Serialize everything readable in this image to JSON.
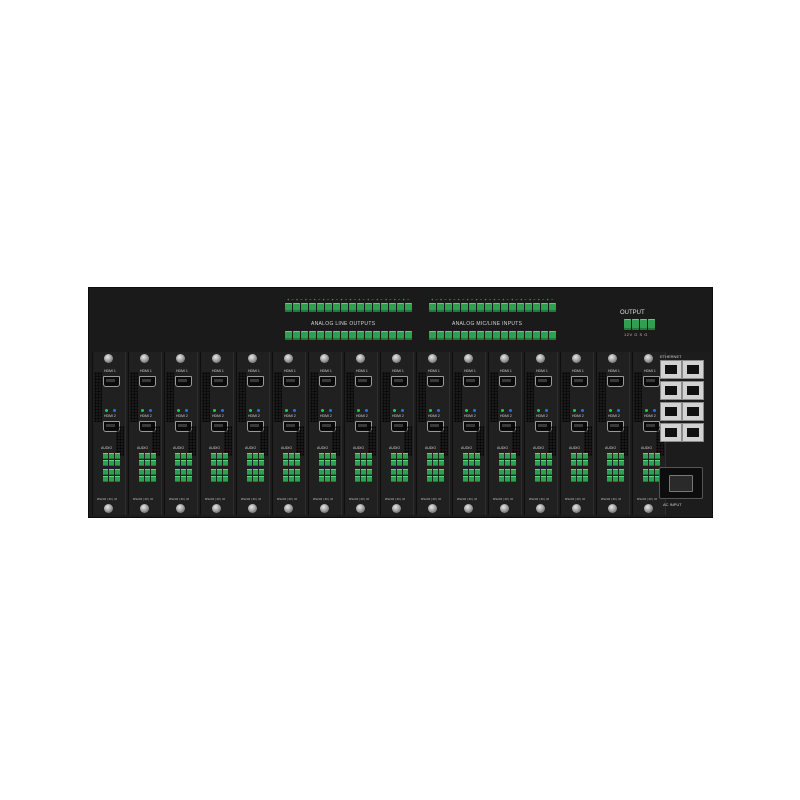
{
  "device": {
    "top_panel": {
      "outputs_label": "ANALOG LINE OUTPUTS",
      "inputs_label": "ANALOG MIC/LINE INPUTS",
      "output_label": "OUTPUT",
      "output_pins": "12V  G    S    G"
    },
    "card_labels": {
      "hdmi1": "HDMI 1",
      "hdmi2": "HDMI 2",
      "audio": "AUDIO",
      "rs232": "RS232 | IR | IO"
    },
    "card_count": 16,
    "side_panel": {
      "ethernet_label": "ETHERNET",
      "ac_label": "AC INPUT"
    },
    "colors": {
      "chassis": "#1c1c1d",
      "terminal_green": "#2fa052",
      "led_green": "#29c25a",
      "led_blue": "#2e6fe0"
    }
  }
}
